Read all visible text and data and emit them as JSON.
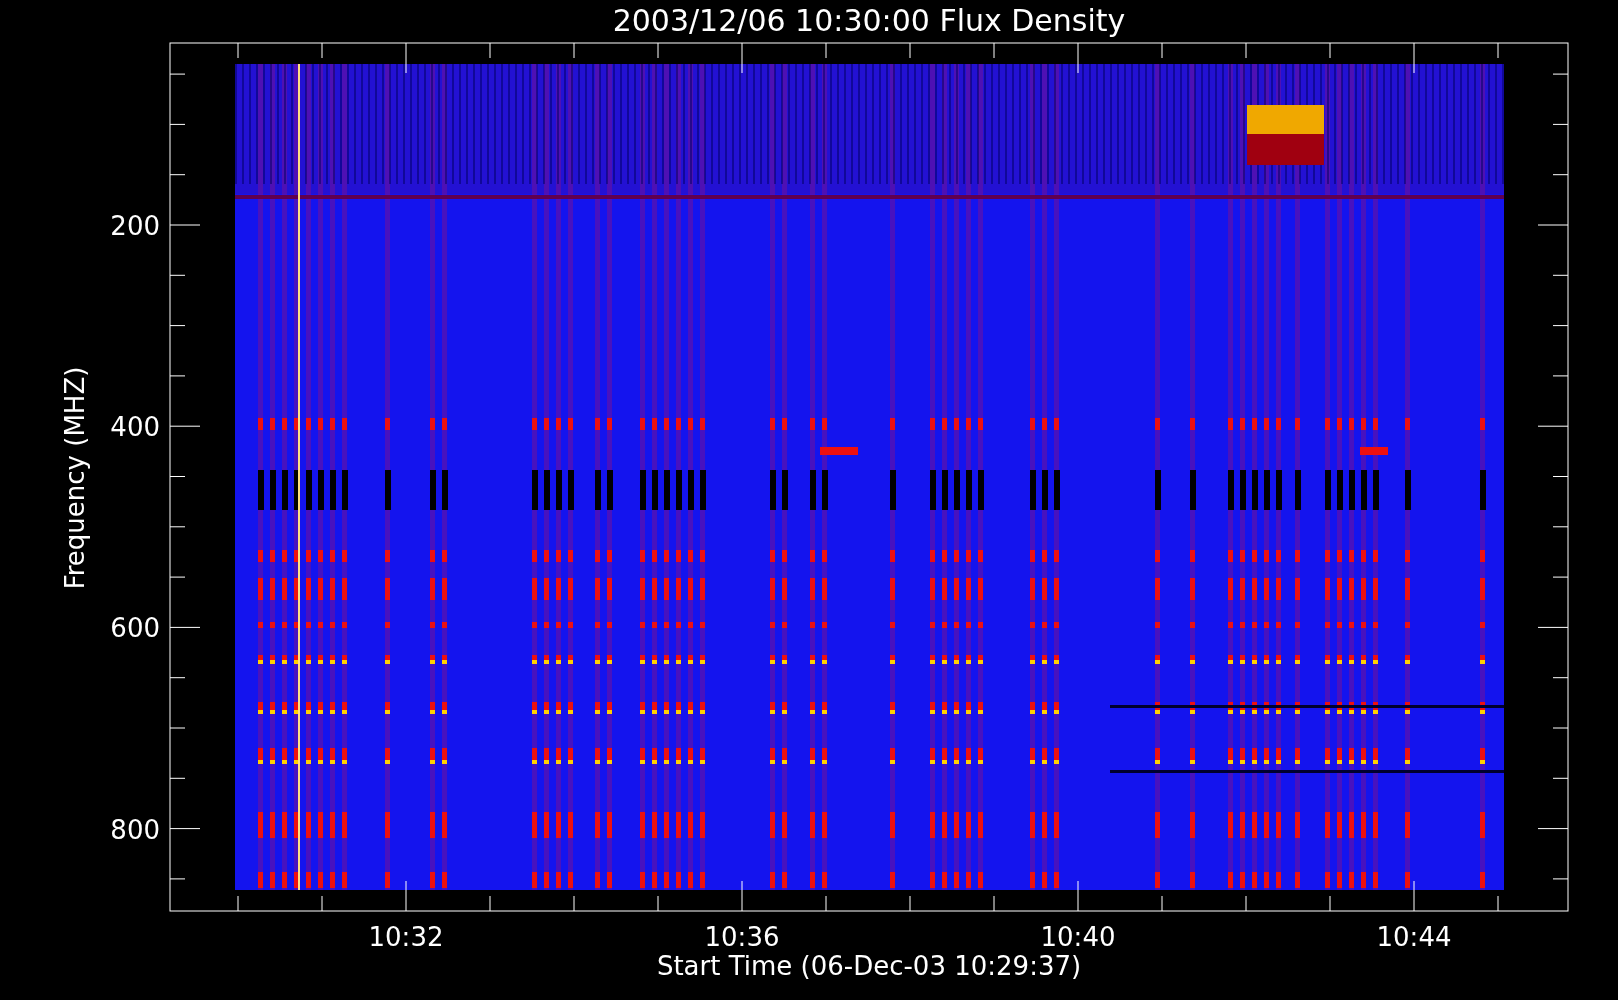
{
  "title": "2003/12/06 10:30:00 Flux Density",
  "y_axis": {
    "label": "Frequency (MHZ)",
    "ticks": [
      "200",
      "400",
      "600",
      "800"
    ]
  },
  "x_axis": {
    "label": "Start Time (06-Dec-03 10:29:37)",
    "ticks": [
      "10:32",
      "10:36",
      "10:40",
      "10:44"
    ]
  }
}
